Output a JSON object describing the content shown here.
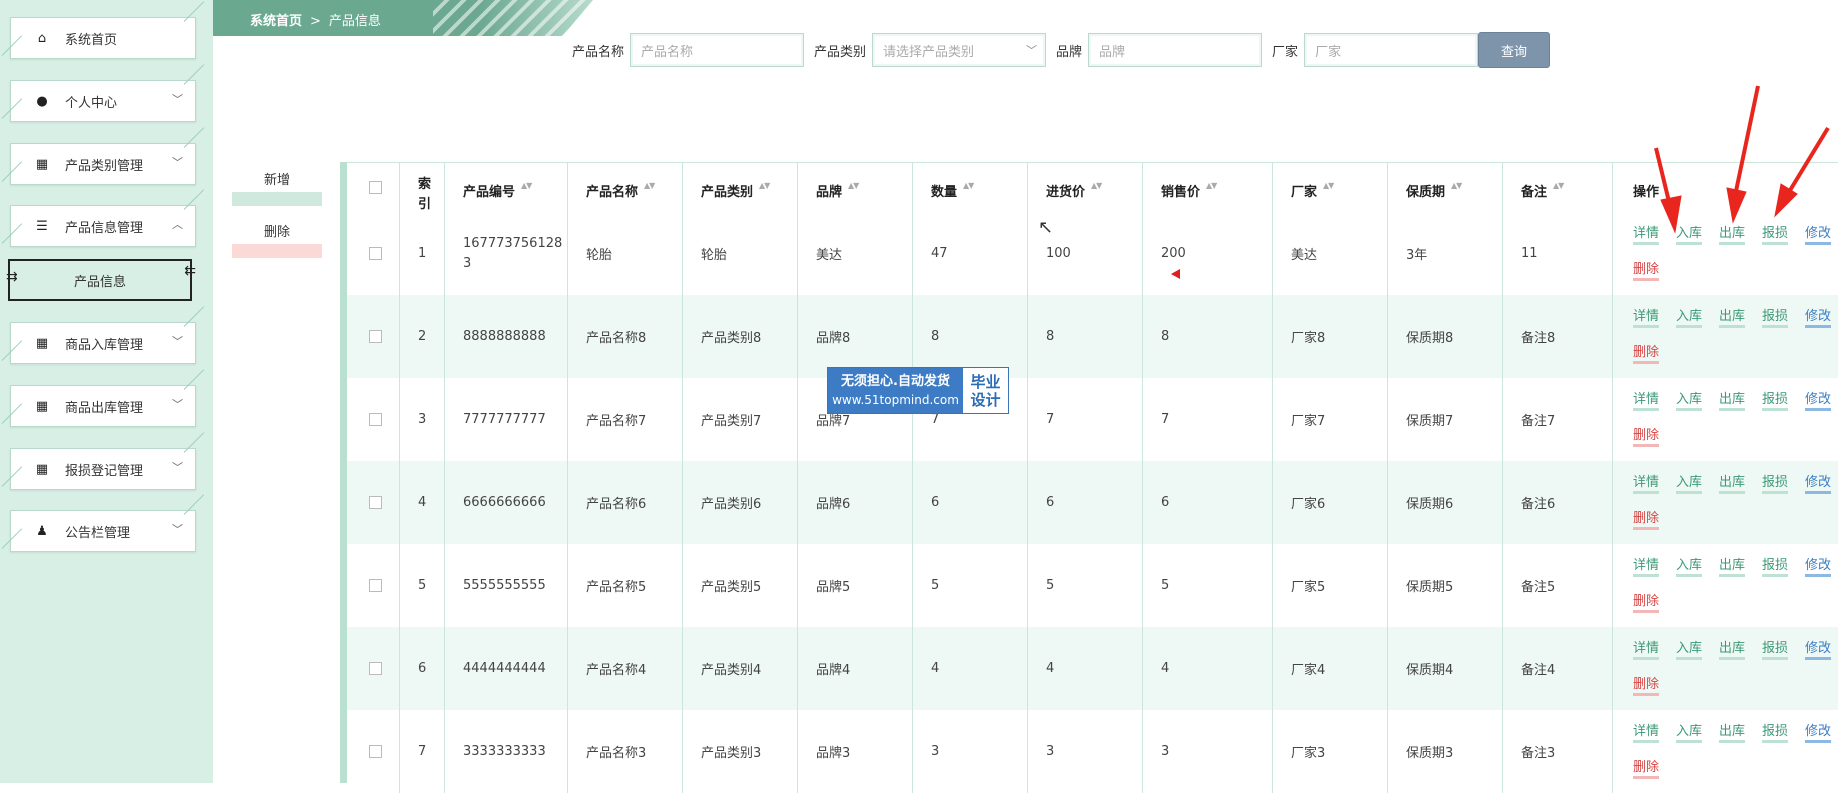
{
  "sidebar": {
    "items": [
      {
        "label": "系统首页",
        "icon": "home-icon",
        "glyph": "⌂",
        "expandable": false
      },
      {
        "label": "个人中心",
        "icon": "user-icon",
        "glyph": "●",
        "expandable": true
      },
      {
        "label": "产品类别管理",
        "icon": "grid-icon",
        "glyph": "▦",
        "expandable": true
      },
      {
        "label": "产品信息管理",
        "icon": "list-icon",
        "glyph": "☰",
        "expandable": true,
        "expanded": true
      },
      {
        "label": "商品入库管理",
        "icon": "grid-icon",
        "glyph": "▦",
        "expandable": true
      },
      {
        "label": "商品出库管理",
        "icon": "grid-icon",
        "glyph": "▦",
        "expandable": true
      },
      {
        "label": "报损登记管理",
        "icon": "grid-icon",
        "glyph": "▦",
        "expandable": true
      },
      {
        "label": "公告栏管理",
        "icon": "stamp-icon",
        "glyph": "♟",
        "expandable": true
      }
    ],
    "sub_item": "产品信息"
  },
  "breadcrumb": {
    "home": "系统首页",
    "sep": ">",
    "current": "产品信息"
  },
  "search": {
    "name_label": "产品名称",
    "name_placeholder": "产品名称",
    "category_label": "产品类别",
    "category_placeholder": "请选择产品类别",
    "brand_label": "品牌",
    "brand_placeholder": "品牌",
    "maker_label": "厂家",
    "maker_placeholder": "厂家",
    "query_label": "查询"
  },
  "actions": {
    "add_label": "新增",
    "delete_label": "删除"
  },
  "table": {
    "headers": [
      "索引",
      "产品编号",
      "产品名称",
      "产品类别",
      "品牌",
      "数量",
      "进货价",
      "销售价",
      "厂家",
      "保质期",
      "备注",
      "操作"
    ],
    "rows": [
      {
        "idx": "1",
        "code": "1677737561283",
        "name": "轮胎",
        "category": "轮胎",
        "brand": "美达",
        "qty": "47",
        "cost": "100",
        "price": "200",
        "maker": "美达",
        "shelf": "3年",
        "note": "11"
      },
      {
        "idx": "2",
        "code": "8888888888",
        "name": "产品名称8",
        "category": "产品类别8",
        "brand": "品牌8",
        "qty": "8",
        "cost": "8",
        "price": "8",
        "maker": "厂家8",
        "shelf": "保质期8",
        "note": "备注8"
      },
      {
        "idx": "3",
        "code": "7777777777",
        "name": "产品名称7",
        "category": "产品类别7",
        "brand": "品牌7",
        "qty": "7",
        "cost": "7",
        "price": "7",
        "maker": "厂家7",
        "shelf": "保质期7",
        "note": "备注7"
      },
      {
        "idx": "4",
        "code": "6666666666",
        "name": "产品名称6",
        "category": "产品类别6",
        "brand": "品牌6",
        "qty": "6",
        "cost": "6",
        "price": "6",
        "maker": "厂家6",
        "shelf": "保质期6",
        "note": "备注6"
      },
      {
        "idx": "5",
        "code": "5555555555",
        "name": "产品名称5",
        "category": "产品类别5",
        "brand": "品牌5",
        "qty": "5",
        "cost": "5",
        "price": "5",
        "maker": "厂家5",
        "shelf": "保质期5",
        "note": "备注5"
      },
      {
        "idx": "6",
        "code": "4444444444",
        "name": "产品名称4",
        "category": "产品类别4",
        "brand": "品牌4",
        "qty": "4",
        "cost": "4",
        "price": "4",
        "maker": "厂家4",
        "shelf": "保质期4",
        "note": "备注4"
      },
      {
        "idx": "7",
        "code": "3333333333",
        "name": "产品名称3",
        "category": "产品类别3",
        "brand": "品牌3",
        "qty": "3",
        "cost": "3",
        "price": "3",
        "maker": "厂家3",
        "shelf": "保质期3",
        "note": "备注3"
      }
    ],
    "ops": {
      "detail": "详情",
      "stock_in": "入库",
      "stock_out": "出库",
      "loss": "报损",
      "edit": "修改",
      "remove": "删除"
    }
  },
  "watermark": {
    "line1": "无须担心.自动发货",
    "line2": "www.51topmind.com",
    "right1": "毕业",
    "right2": "设计"
  }
}
